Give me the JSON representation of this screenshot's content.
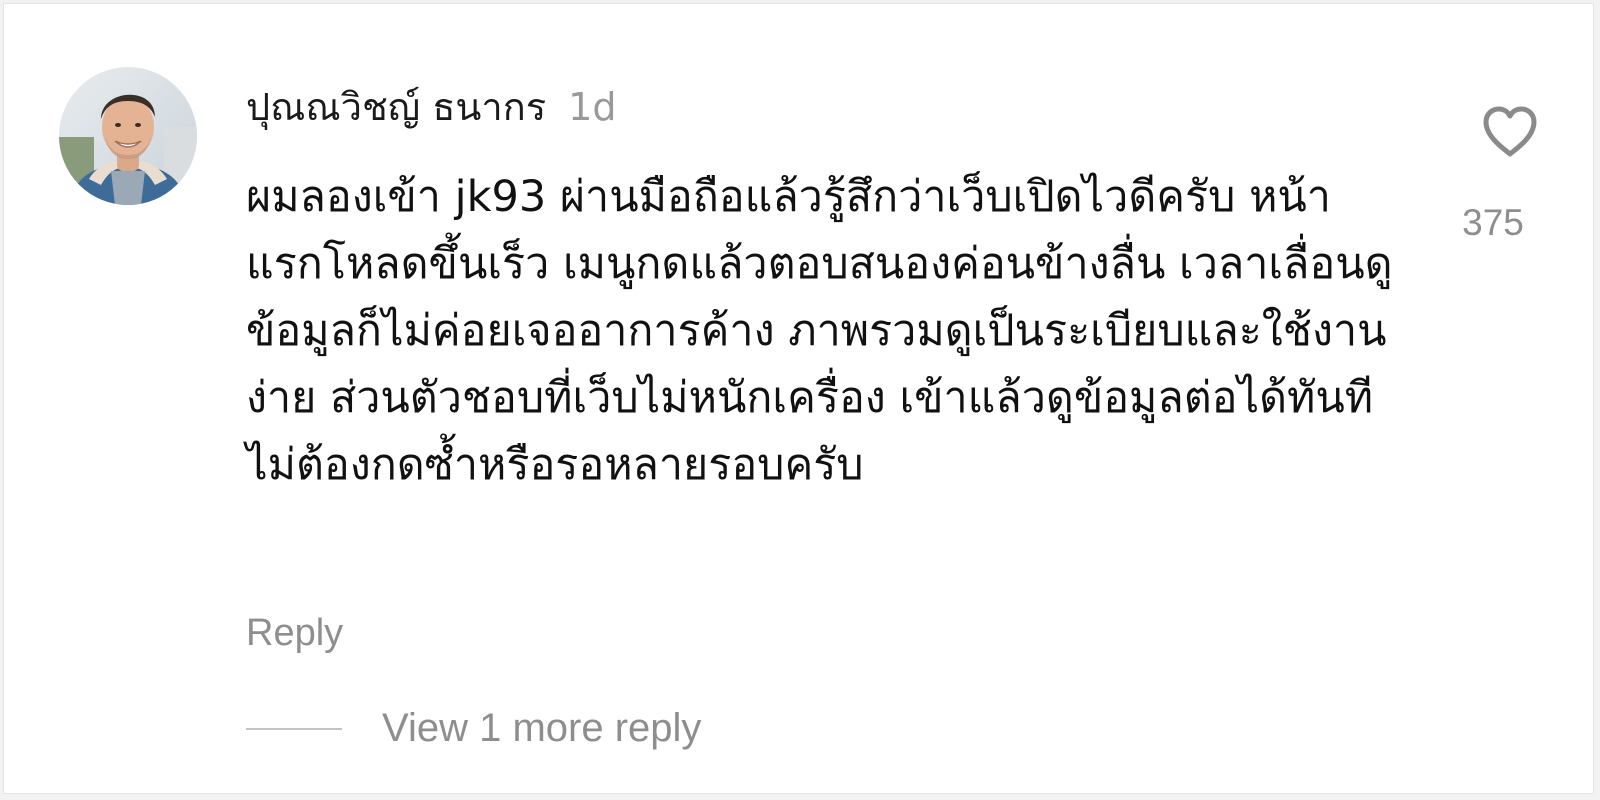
{
  "comment": {
    "author": "ปุณณวิชญ์ ธนากร",
    "timestamp": "1d",
    "text": "ผมลองเข้า jk93 ผ่านมือถือแล้วรู้สึกว่าเว็บเปิดไวดีครับ หน้าแรกโหลดขึ้นเร็ว เมนูกดแล้วตอบสนองค่อนข้างลื่น เวลาเลื่อนดูข้อมูลก็ไม่ค่อยเจออาการค้าง ภาพรวมดูเป็นระเบียบและใช้งานง่าย ส่วนตัวชอบที่เว็บไม่หนักเครื่อง เข้าแล้วดูข้อมูลต่อได้ทันที ไม่ต้องกดซ้ำหรือรอหลายรอบครับ",
    "reply_label": "Reply",
    "view_replies_label": "View 1 more reply",
    "like_count": "375",
    "like_icon": "heart-outline-icon",
    "avatar_icon": "user-avatar-photo"
  },
  "colors": {
    "background": "#f2f2f2",
    "card": "#ffffff",
    "text_primary": "#111111",
    "text_secondary": "#8e8e8e",
    "icon": "#8a8a8a"
  }
}
